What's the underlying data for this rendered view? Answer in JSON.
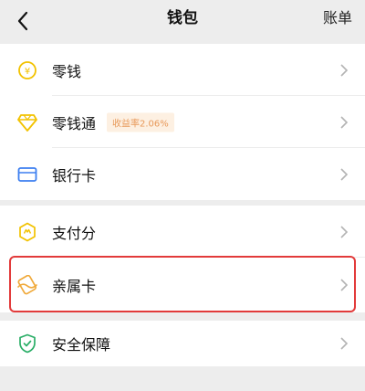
{
  "header": {
    "title": "钱包",
    "bill_label": "账单"
  },
  "group1": {
    "items": [
      {
        "label": "零钱",
        "icon": "coin-yen-icon"
      },
      {
        "label": "零钱通",
        "icon": "diamond-icon",
        "badge": "收益率2.06%"
      },
      {
        "label": "银行卡",
        "icon": "bank-card-icon"
      }
    ]
  },
  "group2": {
    "items": [
      {
        "label": "支付分",
        "icon": "payscore-icon"
      },
      {
        "label": "亲属卡",
        "icon": "family-card-icon"
      }
    ]
  },
  "group3": {
    "items": [
      {
        "label": "安全保障",
        "icon": "shield-check-icon"
      }
    ]
  },
  "colors": {
    "accent_yellow": "#f2c200",
    "highlight_red": "#e23b3b",
    "shield_green": "#2aae67",
    "card_blue": "#3d7ff0"
  }
}
